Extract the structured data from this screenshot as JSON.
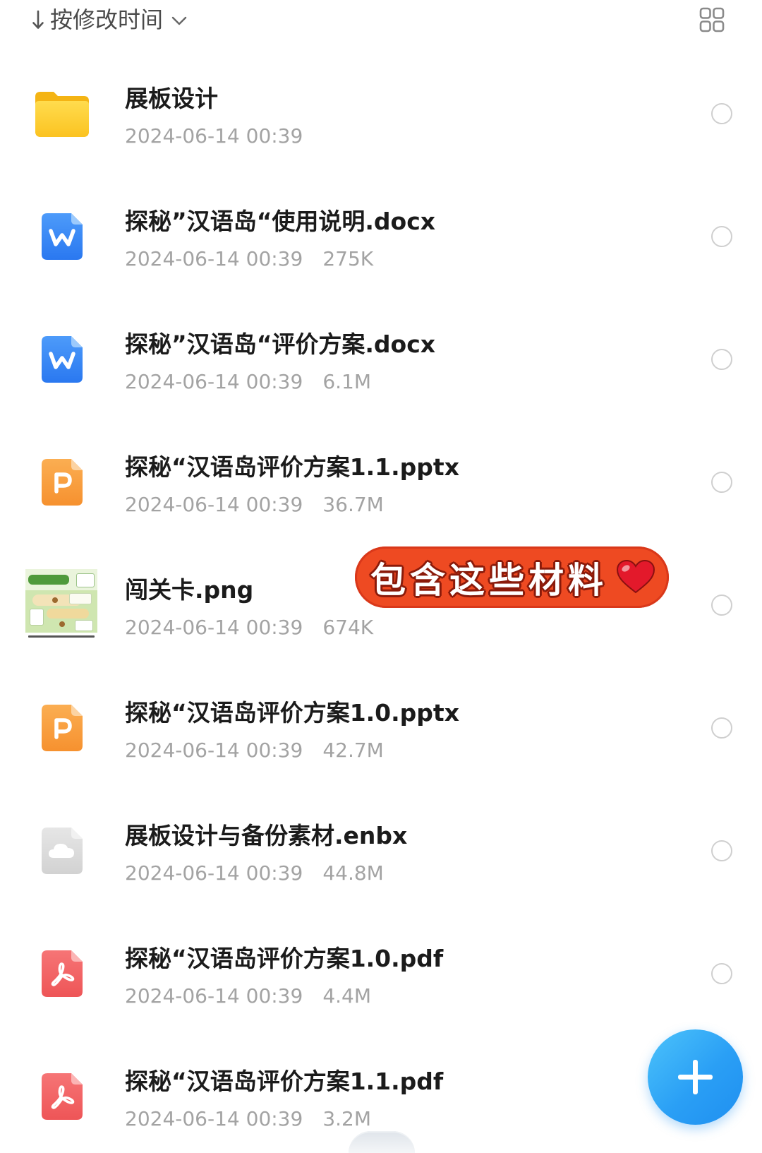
{
  "header": {
    "sort_label": "按修改时间",
    "icons": {
      "sort_direction": "arrow-down-icon",
      "dropdown": "chevron-down-icon",
      "view_toggle": "grid-view-icon"
    }
  },
  "files": [
    {
      "name": "展板设计",
      "date": "2024-06-14 00:39",
      "icon": "folder-icon"
    },
    {
      "name": "探秘”汉语岛“使用说明.docx",
      "date": "2024-06-14 00:39",
      "size": "275K",
      "icon": "word-document-icon"
    },
    {
      "name": "探秘”汉语岛“评价方案.docx",
      "date": "2024-06-14 00:39",
      "size": "6.1M",
      "icon": "word-document-icon"
    },
    {
      "name": "探秘“汉语岛评价方案1.1.pptx",
      "date": "2024-06-14 00:39",
      "size": "36.7M",
      "icon": "powerpoint-icon"
    },
    {
      "name": "闯关卡.png",
      "date": "2024-06-14 00:39",
      "size": "674K",
      "icon": "image-thumbnail"
    },
    {
      "name": "探秘“汉语岛评价方案1.0.pptx",
      "date": "2024-06-14 00:39",
      "size": "42.7M",
      "icon": "powerpoint-icon"
    },
    {
      "name": "展板设计与备份素材.enbx",
      "date": "2024-06-14 00:39",
      "size": "44.8M",
      "icon": "cloud-file-icon"
    },
    {
      "name": "探秘“汉语岛评价方案1.0.pdf",
      "date": "2024-06-14 00:39",
      "size": "4.4M",
      "icon": "pdf-icon"
    },
    {
      "name": "探秘“汉语岛评价方案1.1.pdf",
      "date": "2024-06-14 00:39",
      "size": "3.2M",
      "icon": "pdf-icon"
    }
  ],
  "sticker": {
    "text": "包含这些材料",
    "icon": "red-heart-icon"
  },
  "fab": {
    "icon": "plus-icon"
  },
  "colors": {
    "title_text": "#1b1b1b",
    "date_text": "#a3a3a3",
    "fab_blue": "#2a9ff5",
    "sticker_background": "#ee4a22",
    "word_blue": "#2f7ef5",
    "ppt_orange": "#f89a3a",
    "pdf_red": "#f26465",
    "folder_yellow": "#fcc52a"
  }
}
